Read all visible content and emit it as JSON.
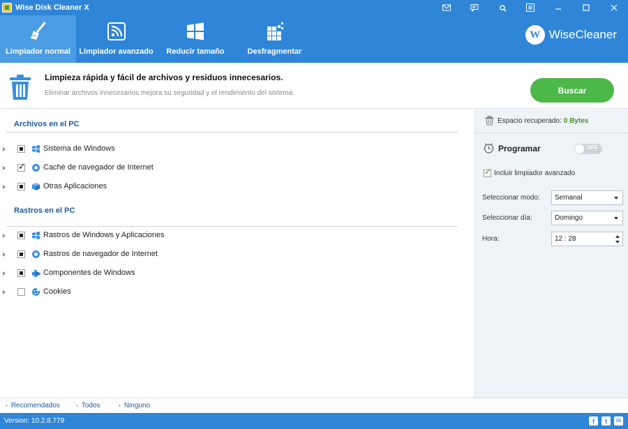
{
  "window": {
    "title": "Wise Disk Cleaner X",
    "title_icons": [
      "mail-icon",
      "feedback-icon",
      "settings-icon",
      "menu-icon",
      "minimize-icon",
      "maximize-icon",
      "close-icon"
    ]
  },
  "toolbar": {
    "tabs": [
      {
        "label": "Limpiador normal",
        "icon": "broom-icon",
        "active": true
      },
      {
        "label": "Limpiador avanzado",
        "icon": "rss-icon",
        "active": false
      },
      {
        "label": "Reducir tamaño",
        "icon": "windows-icon",
        "active": false
      },
      {
        "label": "Desfragmentar",
        "icon": "defrag-icon",
        "active": false
      }
    ],
    "brand_logo": "W",
    "brand_name": "WiseCleaner"
  },
  "header": {
    "title": "Limpieza rápida y fácil de archivos y residuos innecesarios.",
    "subtitle": "Eliminar archivos innecesarios mejora su seguridad y el rendimiento del sistema.",
    "scan_button": "Buscar"
  },
  "sections": [
    {
      "title": "Archivos en el PC",
      "items": [
        {
          "label": "Sistema de Windows",
          "state": "partial",
          "icon": "windows-flag-icon"
        },
        {
          "label": "Caché de navegador de Internet",
          "state": "checked",
          "icon": "browser-icon"
        },
        {
          "label": "Otras Aplicaciones",
          "state": "partial",
          "icon": "cube-icon"
        }
      ]
    },
    {
      "title": "Rastros en el PC",
      "items": [
        {
          "label": "Rastros de Windows y Aplicaciones",
          "state": "partial",
          "icon": "windows-flag-icon"
        },
        {
          "label": "Rastros de navegador de Internet",
          "state": "partial",
          "icon": "browser-icon"
        },
        {
          "label": "Componentes de Windows",
          "state": "partial",
          "icon": "puzzle-icon"
        },
        {
          "label": "Cookies",
          "state": "unchecked",
          "icon": "cookie-icon"
        }
      ]
    }
  ],
  "right": {
    "space_label": "Espacio recuperado:",
    "space_value": "0 Bytes",
    "schedule_title": "Programar",
    "toggle_label": "OFF",
    "include_label": "Incluir limpiador avanzado",
    "mode_label": "Seleccionar modo:",
    "mode_value": "Semanal",
    "day_label": "Seleccionar día:",
    "day_value": "Domingo",
    "time_label": "Hora:",
    "time_value": "12 : 28"
  },
  "bottom": {
    "links": [
      "Recomendados",
      "Todos",
      "Ninguno"
    ],
    "version": "Version: 10.2.8.779"
  },
  "colors": {
    "accent": "#2f86d8",
    "active_tab": "#4b9de3",
    "scan_button": "#4cb848",
    "section_title": "#1c5a9a"
  }
}
